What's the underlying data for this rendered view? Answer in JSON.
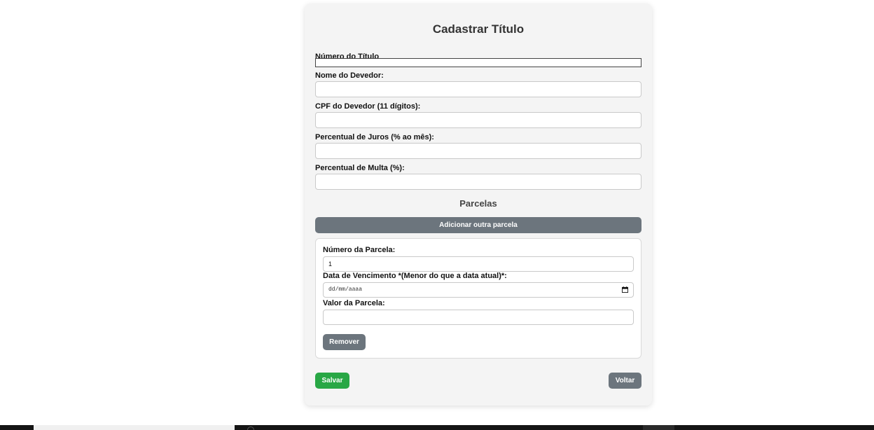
{
  "form": {
    "title": "Cadastrar Título",
    "fields": {
      "numero_titulo": {
        "label": "Número do Título",
        "value": ""
      },
      "nome_devedor": {
        "label": "Nome do Devedor:",
        "value": ""
      },
      "cpf_devedor": {
        "label": "CPF do Devedor (11 dígitos):",
        "value": ""
      },
      "juros": {
        "label": "Percentual de Juros (% ao mês):",
        "value": ""
      },
      "multa": {
        "label": "Percentual de Multa (%):",
        "value": ""
      }
    },
    "parcelas": {
      "section_title": "Parcelas",
      "add_button": "Adicionar outra parcela",
      "item": {
        "numero_label": "Número da Parcela:",
        "numero_value": "1",
        "vencimento_label": "Data de Vencimento *(Menor do que a data atual)*:",
        "vencimento_placeholder": "dd/mm/aaaa",
        "valor_label": "Valor da Parcela:",
        "valor_value": "",
        "remove_button": "Remover"
      }
    },
    "save_button": "Salvar",
    "back_button": "Voltar"
  },
  "colors": {
    "save": "#28a745",
    "secondary": "#6c757d",
    "card_bg": "#f4f4f4"
  },
  "icons": {
    "calendar": "calendar-icon",
    "taskbar_search": "search-icon"
  }
}
